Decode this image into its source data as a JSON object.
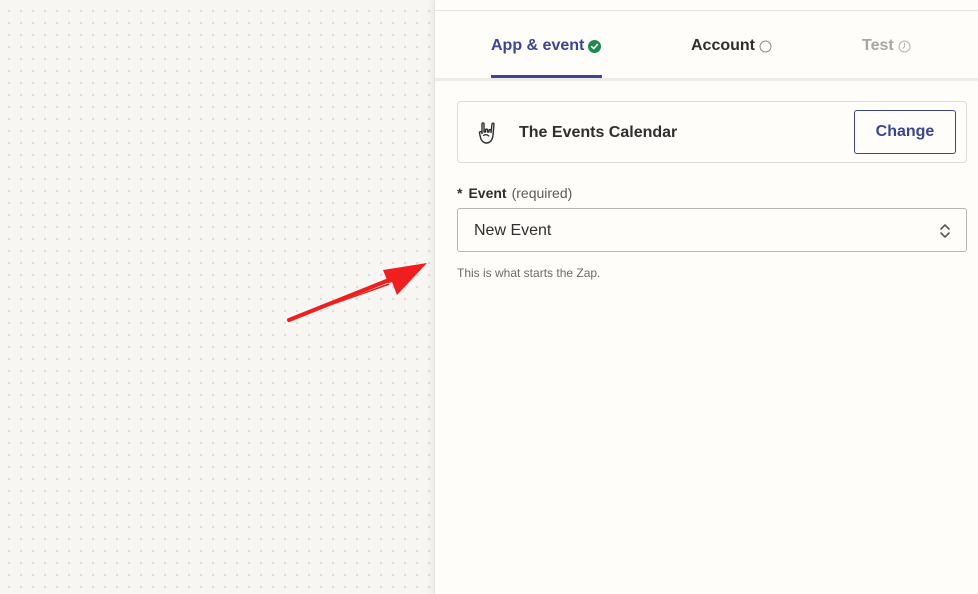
{
  "tabs": [
    {
      "label": "App & event",
      "state": "complete",
      "icon": "check-circle-icon"
    },
    {
      "label": "Account",
      "state": "pending",
      "icon": "circle-outline-icon"
    },
    {
      "label": "Test",
      "state": "disabled",
      "icon": "clock-icon"
    }
  ],
  "app": {
    "name": "The Events Calendar",
    "icon": "rock-hand-icon",
    "change_label": "Change"
  },
  "event_field": {
    "required_mark": "*",
    "label": "Event",
    "hint": "(required)",
    "value": "New Event",
    "help": "This is what starts the Zap."
  },
  "colors": {
    "accent": "#3d4592",
    "success": "#1e8a4f",
    "annotation_arrow": "#f01e1e"
  }
}
